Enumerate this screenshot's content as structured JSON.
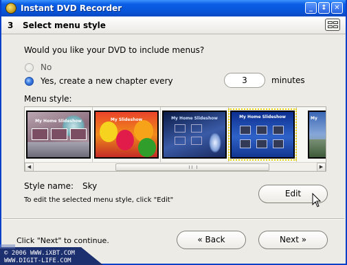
{
  "window": {
    "title": "Instant DVD Recorder",
    "buttons": [
      "_",
      "↕",
      "✕"
    ]
  },
  "header": {
    "step_number": "3",
    "step_title": "Select menu style",
    "layout_icon": "layout-grid-icon"
  },
  "question": "Would you like your DVD to include menus?",
  "options": {
    "no_label": "No",
    "yes_label": "Yes, create a new chapter every",
    "selected": "yes"
  },
  "chapter_minutes": {
    "value": "3",
    "unit": "minutes"
  },
  "menu_style_label": "Menu style:",
  "thumbnails": [
    {
      "title": "My Home Slideshow",
      "selected": false
    },
    {
      "title": "My Slideshow",
      "selected": false
    },
    {
      "title": "My Home Slideshow",
      "selected": false
    },
    {
      "title": "My Home Slideshow",
      "selected": true
    },
    {
      "title": "My",
      "selected": false
    }
  ],
  "style_name": {
    "label": "Style name:",
    "value": "Sky"
  },
  "edit_hint": "To edit the selected menu style, click \"Edit\"",
  "edit_button": "Edit",
  "footer": {
    "hint": "Click \"Next\" to continue.",
    "back_label": "« Back",
    "next_label": "Next »"
  },
  "watermark": {
    "line1": "© 2006 WWW.iXBT.COM",
    "line2": "WWW.DIGIT-LIFE.COM"
  }
}
